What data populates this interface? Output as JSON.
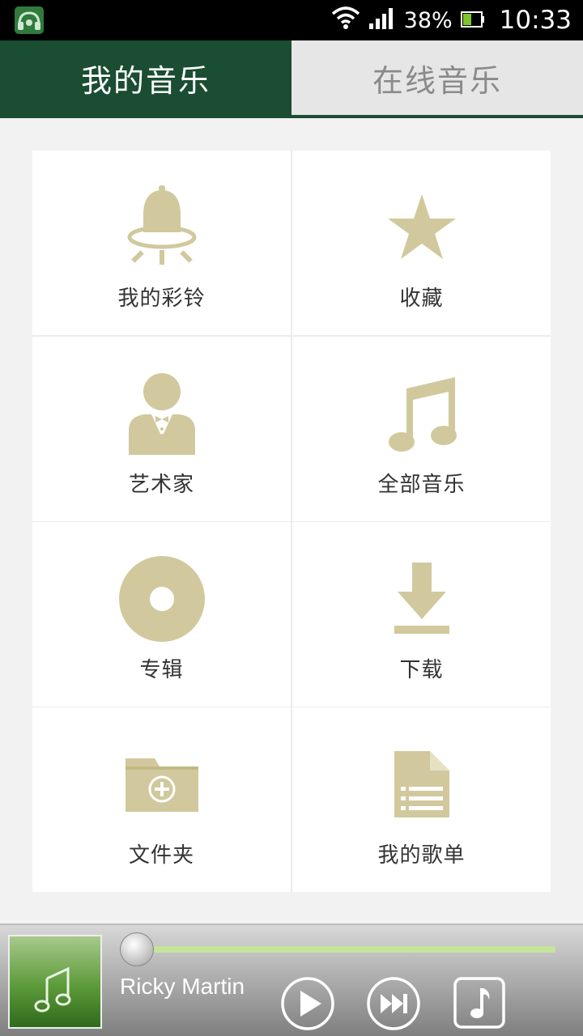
{
  "status": {
    "battery": "38%",
    "time": "10:33",
    "icons": [
      "app-headphones-icon",
      "wifi-icon",
      "signal-icon",
      "battery-icon"
    ]
  },
  "tabs": [
    {
      "label": "我的音乐",
      "active": true
    },
    {
      "label": "在线音乐",
      "active": false
    }
  ],
  "menu": [
    {
      "label": "我的彩铃",
      "icon": "bell-icon"
    },
    {
      "label": "收藏",
      "icon": "star-icon"
    },
    {
      "label": "艺术家",
      "icon": "artist-icon"
    },
    {
      "label": "全部音乐",
      "icon": "music-note-icon"
    },
    {
      "label": "专辑",
      "icon": "album-disc-icon"
    },
    {
      "label": "下载",
      "icon": "download-icon"
    },
    {
      "label": "文件夹",
      "icon": "folder-icon"
    },
    {
      "label": "我的歌单",
      "icon": "playlist-icon"
    }
  ],
  "player": {
    "track": "Ricky Martin",
    "progress": 0.0,
    "controls": [
      "play-icon",
      "next-icon",
      "now-playing-icon"
    ]
  },
  "colors": {
    "accent": "#1b4d32",
    "icon": "#d1c99d",
    "seek": "#c6e39a"
  }
}
